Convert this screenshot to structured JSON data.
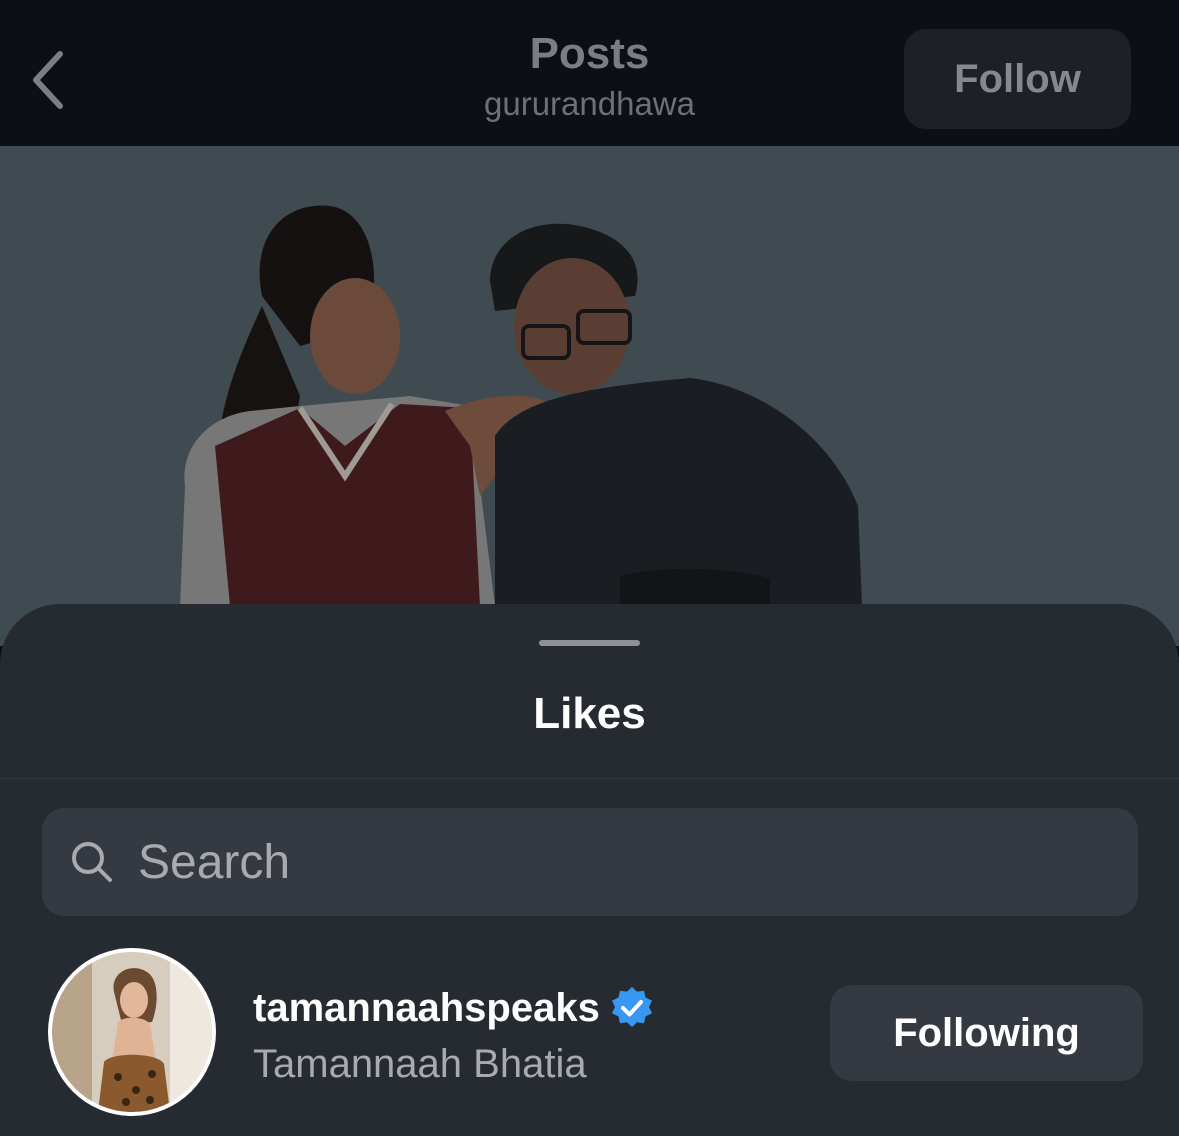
{
  "header": {
    "title": "Posts",
    "subtitle": "gururandhawa",
    "back_icon": "chevron-left-icon",
    "follow_label": "Follow"
  },
  "post": {
    "image_icon": "post-photo"
  },
  "sheet": {
    "title": "Likes",
    "search": {
      "placeholder": "Search",
      "icon": "search-icon"
    },
    "users": [
      {
        "username": "tamannaahspeaks",
        "full_name": "Tamannaah Bhatia",
        "verified": true,
        "button_label": "Following"
      }
    ]
  },
  "colors": {
    "background": "#0c0f14",
    "sheet": "#262a31",
    "input": "#353942",
    "verified": "#3897f0",
    "text_primary": "#ffffff",
    "text_secondary": "#a7aaaf"
  }
}
